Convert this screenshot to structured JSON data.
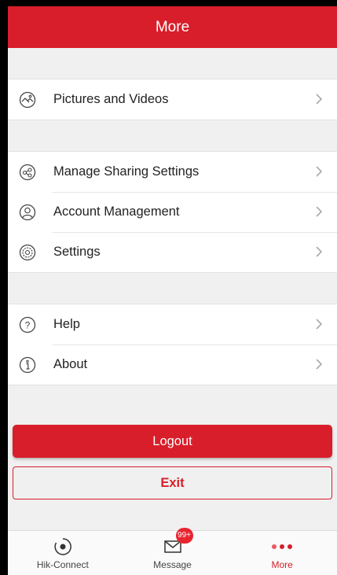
{
  "header": {
    "title": "More"
  },
  "menu": {
    "group1": [
      {
        "label": "Pictures and Videos",
        "icon": "pictures-icon"
      }
    ],
    "group2": [
      {
        "label": "Manage Sharing Settings",
        "icon": "share-icon"
      },
      {
        "label": "Account Management",
        "icon": "account-icon"
      },
      {
        "label": "Settings",
        "icon": "gear-icon"
      }
    ],
    "group3": [
      {
        "label": "Help",
        "icon": "help-icon"
      },
      {
        "label": "About",
        "icon": "info-icon"
      }
    ]
  },
  "actions": {
    "logout_label": "Logout",
    "exit_label": "Exit"
  },
  "tabbar": {
    "tabs": [
      {
        "label": "Hik-Connect",
        "icon": "hik-connect-icon"
      },
      {
        "label": "Message",
        "icon": "mail-icon",
        "badge": "99+"
      },
      {
        "label": "More",
        "icon": "more-dots-icon"
      }
    ],
    "active": "More"
  },
  "colors": {
    "accent": "#d81e2a",
    "background": "#f0f0f0"
  }
}
